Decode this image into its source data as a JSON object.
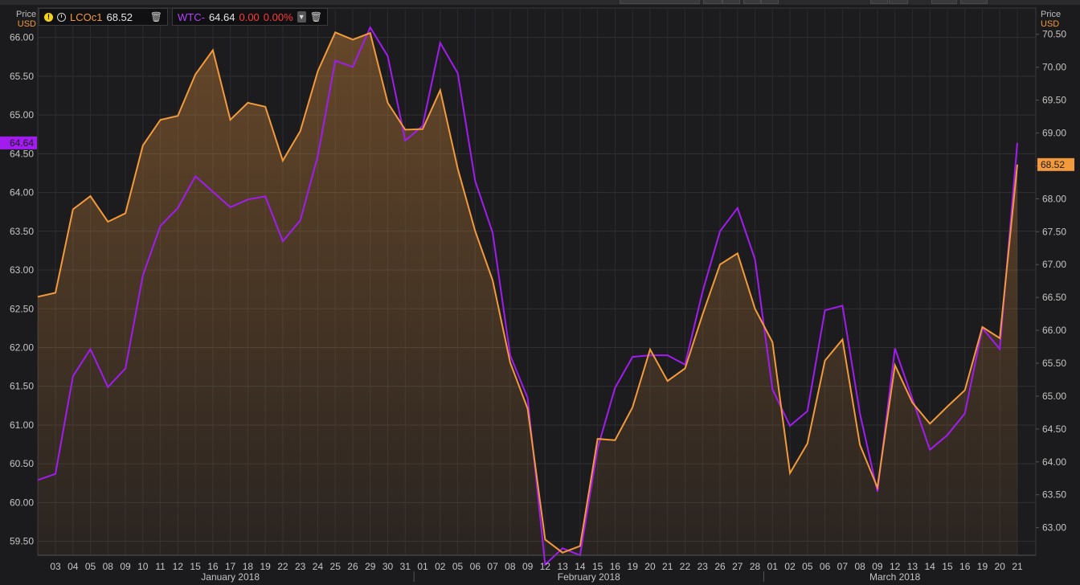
{
  "legend": {
    "series1": {
      "symbol": "LCOc1",
      "value": "68.52"
    },
    "series2": {
      "symbol": "WTC-",
      "value": "64.64",
      "change": "0.00",
      "change_pct": "0.00%"
    }
  },
  "axis_titles": {
    "left": {
      "label": "Price",
      "unit": "USD"
    },
    "right": {
      "label": "Price",
      "unit": "USD"
    }
  },
  "colors": {
    "lco": "#f39a3c",
    "wtc": "#a21cf0",
    "background": "#1b1b1d",
    "grid": "#333336",
    "change": "#ff3b3b"
  },
  "chart_data": {
    "type": "line",
    "x": [
      "03",
      "04",
      "05",
      "08",
      "09",
      "10",
      "11",
      "12",
      "15",
      "16",
      "17",
      "18",
      "19",
      "22",
      "23",
      "24",
      "25",
      "26",
      "29",
      "30",
      "31",
      "01",
      "02",
      "05",
      "06",
      "07",
      "08",
      "09",
      "12",
      "13",
      "14",
      "15",
      "16",
      "19",
      "20",
      "21",
      "22",
      "23",
      "26",
      "27",
      "28",
      "01",
      "02",
      "05",
      "06",
      "07",
      "08",
      "09",
      "12",
      "13",
      "14",
      "15",
      "16",
      "19",
      "20",
      "21"
    ],
    "month_labels": [
      {
        "label": "January 2018",
        "start": 0,
        "end": 20
      },
      {
        "label": "February 2018",
        "start": 21,
        "end": 40
      },
      {
        "label": "March 2018",
        "start": 41,
        "end": 55
      }
    ],
    "left_axis": {
      "ticks": [
        "59.50",
        "60.00",
        "60.50",
        "61.00",
        "61.50",
        "62.00",
        "62.50",
        "63.00",
        "63.50",
        "64.00",
        "64.50",
        "65.00",
        "65.50",
        "66.00"
      ],
      "range": [
        59.32,
        66.38
      ]
    },
    "right_axis": {
      "ticks": [
        "63.00",
        "63.50",
        "64.00",
        "64.50",
        "65.00",
        "65.50",
        "66.00",
        "66.50",
        "67.00",
        "67.50",
        "68.00",
        "68.50",
        "69.00",
        "69.50",
        "70.00",
        "70.50"
      ],
      "range": [
        62.58,
        70.9
      ]
    },
    "series": [
      {
        "name": "LCOc1",
        "axis": "right",
        "last_label": "68.52",
        "values": [
          66.57,
          67.84,
          68.04,
          67.65,
          67.78,
          68.81,
          69.2,
          69.26,
          69.89,
          70.26,
          69.2,
          69.46,
          69.4,
          68.58,
          69.03,
          69.94,
          70.53,
          70.42,
          70.52,
          69.46,
          69.05,
          69.06,
          69.65,
          68.46,
          67.51,
          66.76,
          65.51,
          64.81,
          62.82,
          62.62,
          62.72,
          64.35,
          64.33,
          64.83,
          65.71,
          65.23,
          65.42,
          66.24,
          67.0,
          67.17,
          66.33,
          65.82,
          63.83,
          64.28,
          65.54,
          65.86,
          64.26,
          63.61,
          65.47,
          64.9,
          64.58,
          64.84,
          65.09,
          66.05,
          65.88,
          68.52
        ]
      },
      {
        "name": "WTC-",
        "axis": "left",
        "last_label": "64.64",
        "values": [
          60.37,
          61.63,
          61.98,
          61.49,
          61.73,
          62.93,
          63.57,
          63.8,
          64.21,
          64.01,
          63.81,
          63.91,
          63.95,
          63.37,
          63.64,
          64.47,
          65.7,
          65.62,
          66.13,
          65.76,
          64.67,
          64.86,
          65.93,
          65.54,
          64.15,
          63.48,
          61.9,
          61.35,
          59.2,
          59.41,
          59.32,
          60.7,
          61.48,
          61.88,
          61.9,
          61.9,
          61.78,
          62.72,
          63.5,
          63.8,
          63.14,
          61.46,
          60.99,
          61.18,
          62.48,
          62.54,
          61.15,
          60.14,
          61.99,
          61.34,
          60.68,
          60.87,
          61.15,
          62.25,
          61.98,
          64.64
        ]
      }
    ],
    "grid": true
  }
}
